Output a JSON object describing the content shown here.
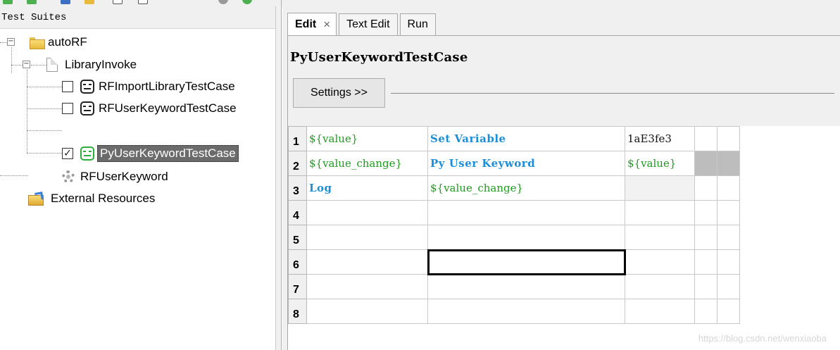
{
  "left_panel": {
    "header": "Test Suites",
    "tree": {
      "root_label": "autoRF",
      "suite_label": "LibraryInvoke",
      "cases": [
        {
          "label": "RFImportLibraryTestCase",
          "checked": false,
          "check_glyph": ""
        },
        {
          "label": "RFUserKeywordTestCase",
          "checked": false,
          "check_glyph": ""
        },
        {
          "label": "PyUserKeywordTestCase",
          "checked": true,
          "check_glyph": "✓"
        }
      ],
      "keyword_label": "RFUserKeyword",
      "external_label": "External Resources",
      "expander_glyph": "−"
    }
  },
  "tabs": [
    {
      "label": "Edit",
      "close": "×"
    },
    {
      "label": "Text Edit"
    },
    {
      "label": "Run"
    }
  ],
  "editor": {
    "title": "PyUserKeywordTestCase",
    "settings_label": "Settings >>",
    "rows": [
      {
        "num": "1",
        "c1": "${value}",
        "c2": "Set Variable",
        "c3": "1aE3fe3",
        "c4": "",
        "c5": ""
      },
      {
        "num": "2",
        "c1": "${value_change}",
        "c2": "Py User Keyword",
        "c3": "${value}",
        "c4": "",
        "c5": ""
      },
      {
        "num": "3",
        "c1": "Log",
        "c2": "${value_change}",
        "c3": "",
        "c4": "",
        "c5": ""
      },
      {
        "num": "4",
        "c1": "",
        "c2": "",
        "c3": "",
        "c4": "",
        "c5": ""
      },
      {
        "num": "5",
        "c1": "",
        "c2": "",
        "c3": "",
        "c4": "",
        "c5": ""
      },
      {
        "num": "6",
        "c1": "",
        "c2": "",
        "c3": "",
        "c4": "",
        "c5": ""
      },
      {
        "num": "7",
        "c1": "",
        "c2": "",
        "c3": "",
        "c4": "",
        "c5": ""
      },
      {
        "num": "8",
        "c1": "",
        "c2": "",
        "c3": "",
        "c4": "",
        "c5": ""
      }
    ]
  },
  "watermark": "https://blog.csdn.net/wenxiaoba",
  "colors": {
    "variable": "#1e9c1e",
    "keyword": "#1a8fd8",
    "selection": "#6b6b6b"
  }
}
